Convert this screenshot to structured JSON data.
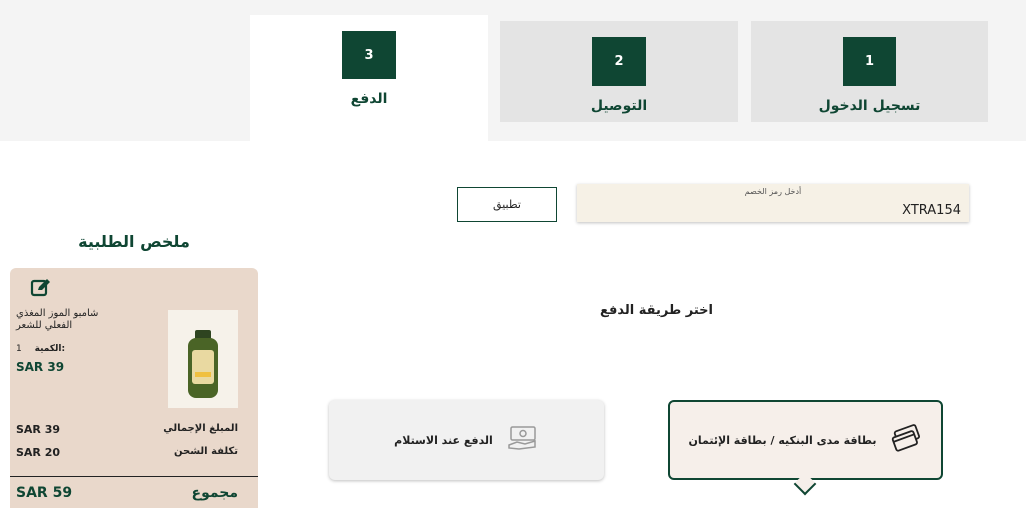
{
  "steps": [
    {
      "number": "1",
      "label": "تسجيل الدخول"
    },
    {
      "number": "2",
      "label": "التوصيل"
    },
    {
      "number": "3",
      "label": "الدفع"
    }
  ],
  "promo": {
    "label": "أدخل رمز الخصم",
    "value": "XTRA154",
    "apply_label": "تطبيق"
  },
  "order_summary": {
    "title": "ملخص الطلبية",
    "product": {
      "name": "شامبو الموز المغذي الفعلي للشعر",
      "qty_label": "الكمية:",
      "qty": "1",
      "price": "SAR 39"
    },
    "rows": [
      {
        "label": "المبلغ الإجمالي",
        "value": "SAR 39"
      },
      {
        "label": "تكلفة الشحن",
        "value": "SAR 20"
      }
    ],
    "total": {
      "label": "مجموع",
      "value": "SAR 59"
    }
  },
  "payment": {
    "title": "اختر طريقة الدفع",
    "options": [
      {
        "label": "بطاقة مدى البنكيه / بطاقة الإئتمان",
        "icon": "credit-cards-icon",
        "selected": true
      },
      {
        "label": "الدفع عند الاستلام",
        "icon": "cash-icon",
        "selected": false
      }
    ]
  },
  "colors": {
    "brand": "#0f4633",
    "summary_bg": "#e9d8cb",
    "promo_bg": "#f6f1e6"
  }
}
